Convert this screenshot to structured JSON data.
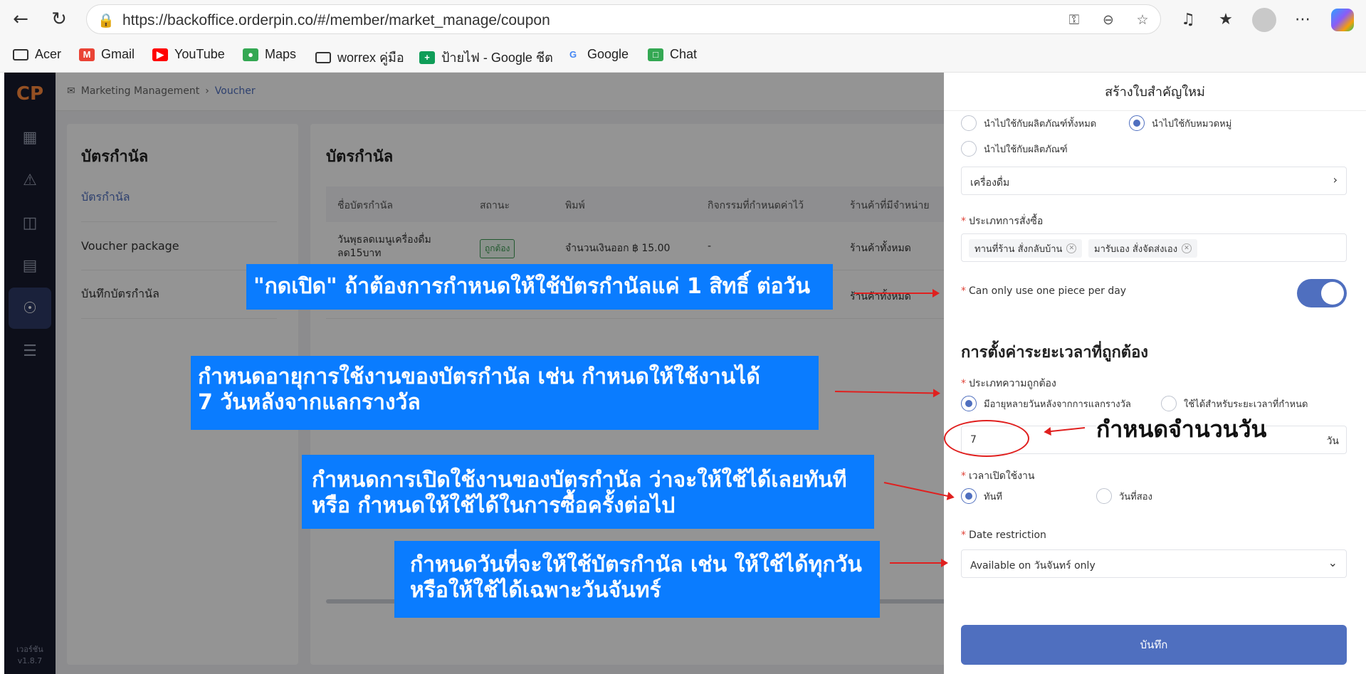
{
  "browser": {
    "url": "https://backoffice.orderpin.co/#/member/market_manage/coupon",
    "bookmarks": [
      "Acer",
      "Gmail",
      "YouTube",
      "Maps",
      "worrex คู่มือ",
      "ป้ายไฟ - Google ชีต",
      "Google",
      "Chat"
    ]
  },
  "app": {
    "breadcrumb": {
      "parent": "Marketing Management",
      "current": "Voucher"
    },
    "version": {
      "label": "เวอร์ชัน",
      "value": "v1.8.7"
    },
    "left_panel": {
      "title": "บัตรกำนัล",
      "items": [
        "บัตรกำนัล",
        "Voucher package",
        "บันทึกบัตรกำนัล"
      ]
    },
    "main_panel": {
      "title": "บัตรกำนัล",
      "columns": [
        "ชื่อบัตรกำนัล",
        "สถานะ",
        "พิมพ์",
        "กิจกรรมที่กำหนดค่าไว้",
        "ร้านค้าที่มีจำหน่าย"
      ],
      "rows": [
        {
          "name": "วันพุธลดเมนูเครื่องดื่ม ลด15บาท",
          "status": "ถูกต้อง",
          "type": "จำนวนเงินออก ฿ 15.00",
          "activity": "-",
          "store": "ร้านค้าทั้งหมด"
        },
        {
          "store": "ร้านค้าทั้งหมด"
        }
      ]
    }
  },
  "drawer": {
    "title": "สร้างใบสำคัญใหม่",
    "apply_options": [
      "นำไปใช้กับผลิตภัณฑ์ทั้งหมด",
      "นำไปใช้กับหมวดหมู่",
      "นำไปใช้กับผลิตภัณฑ์"
    ],
    "category_value": "เครื่องดื่ม",
    "order_type_label": "ประเภทการสั่งซื้อ",
    "order_types": [
      "ทานที่ร้าน สั่งกลับบ้าน",
      "มารับเอง สั่งจัดส่งเอง"
    ],
    "one_per_day_label": "Can only use one piece per day",
    "one_per_day_on": true,
    "validity_section": "การตั้งค่าระยะเวลาที่ถูกต้อง",
    "validity_type_label": "ประเภทความถูกต้อง",
    "validity_options": [
      "มีอายุหลายวันหลังจากการแลกรางวัล",
      "ใช้ได้สำหรับระยะเวลาที่กำหนด"
    ],
    "days_value": "7",
    "days_unit": "วัน",
    "start_label": "เวลาเปิดใช้งาน",
    "start_options": [
      "ทันที",
      "วันที่สอง"
    ],
    "date_restriction_label": "Date restriction",
    "date_restriction_value": "Available on วันจันทร์ only",
    "save_label": "บันทึก"
  },
  "annotations": {
    "callout_1": "\"กดเปิด\" ถ้าต้องการกำหนดให้ใช้บัตรกำนัลแค่ 1 สิทธิ์ ต่อวัน",
    "callout_2_line1": "กำหนดอายุการใช้งานของบัตรกำนัล เช่น กำหนดให้ใช้งานได้",
    "callout_2_line2": "7 วันหลังจากแลกรางวัล",
    "callout_3_line1": "กำหนดการเปิดใช้งานของบัตรกำนัล ว่าจะให้ใช้ได้เลยทันที",
    "callout_3_line2": "หรือ กำหนดให้ใช้ได้ในการซื้อครั้งต่อไป",
    "callout_4_line1": "กำหนดวันที่จะให้ใช้บัตรกำนัล เช่น ให้ใช้ได้ทุกวัน",
    "callout_4_line2": "หรือให้ใช้ได้เฉพาะวันจันทร์",
    "days_note": "กำหนดจำนวนวัน"
  }
}
